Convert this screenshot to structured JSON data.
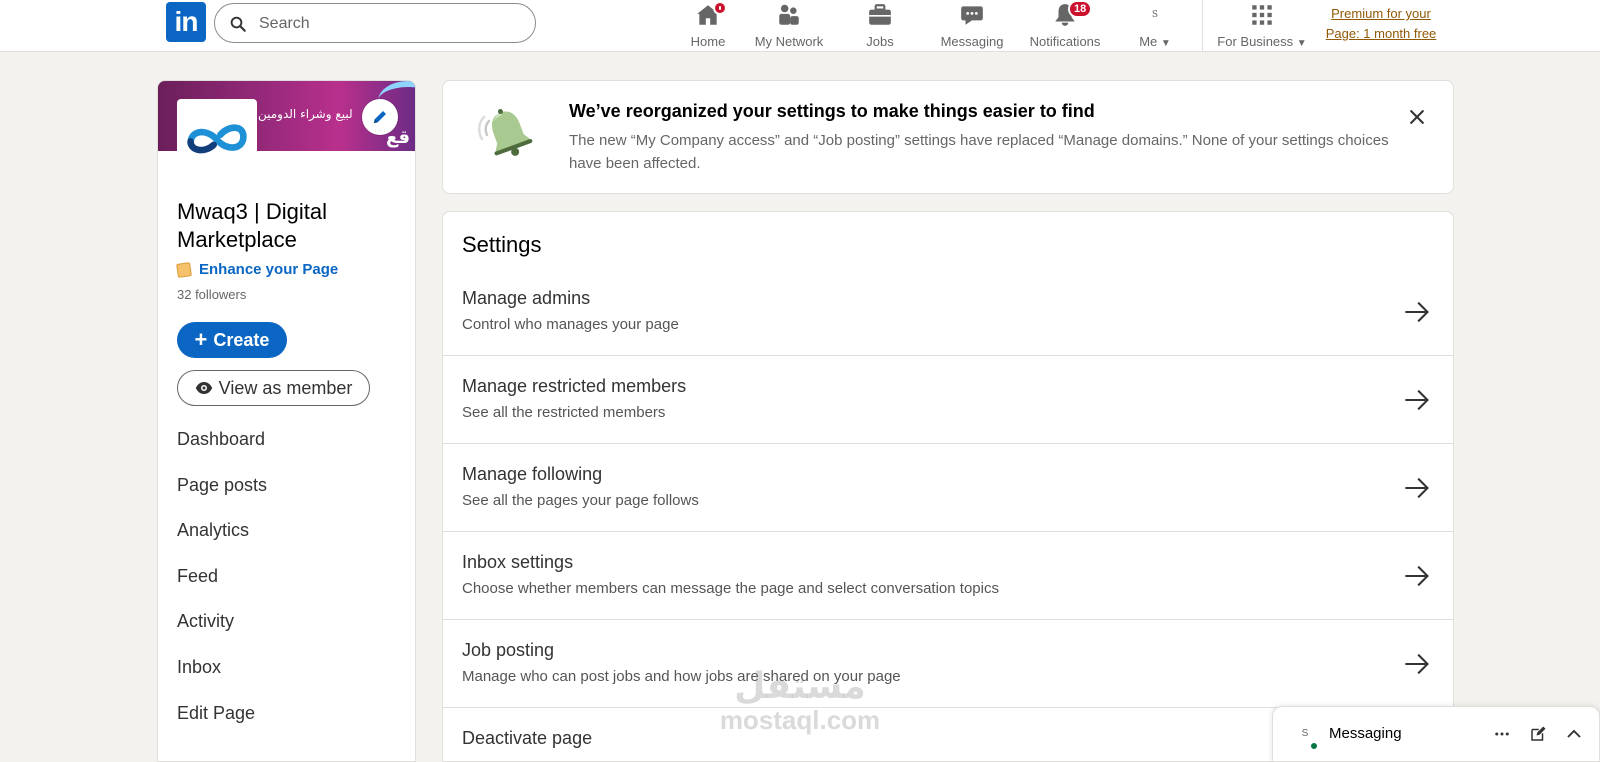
{
  "brand": {
    "logo_text": "in"
  },
  "search": {
    "placeholder": "Search"
  },
  "nav": [
    {
      "label": "Home",
      "icon": "home-icon",
      "badge": "dot"
    },
    {
      "label": "My Network",
      "icon": "people-icon"
    },
    {
      "label": "Jobs",
      "icon": "briefcase-icon"
    },
    {
      "label": "Messaging",
      "icon": "chat-icon"
    },
    {
      "label": "Notifications",
      "icon": "bell-icon",
      "badge": "18"
    },
    {
      "label": "Me",
      "icon": "avatar-icon",
      "avatar_text": "S"
    },
    {
      "label": "For Business",
      "icon": "grid-icon"
    }
  ],
  "premium": {
    "line1": "Premium for your",
    "line2": "Page: 1 month free"
  },
  "company": {
    "banner_text": "لبيع وشراء الدومين",
    "banner_arabic": "قع",
    "name": "Mwaq3 | Digital Marketplace",
    "enhance_label": "Enhance your Page",
    "followers": "32 followers",
    "create_label": "Create",
    "view_label": "View as member"
  },
  "side_nav": [
    "Dashboard",
    "Page posts",
    "Analytics",
    "Feed",
    "Activity",
    "Inbox",
    "Edit Page"
  ],
  "notice": {
    "title": "We’ve reorganized your settings to make things easier to find",
    "body": "The new “My Company access” and “Job posting” settings have replaced “Manage domains.” None of your settings choices have been affected."
  },
  "settings": {
    "heading": "Settings",
    "rows": [
      {
        "title": "Manage admins",
        "subtitle": "Control who manages your page"
      },
      {
        "title": "Manage restricted members",
        "subtitle": "See all the restricted members"
      },
      {
        "title": "Manage following",
        "subtitle": "See all the pages your page follows"
      },
      {
        "title": "Inbox settings",
        "subtitle": "Choose whether members can message the page and select conversation topics"
      },
      {
        "title": "Job posting",
        "subtitle": "Manage who can post jobs and how jobs are shared on your page"
      },
      {
        "title": "Deactivate page",
        "subtitle": ""
      }
    ]
  },
  "watermark": {
    "arabic": "مستقل",
    "latin": "mostaql.com"
  },
  "messaging_bar": {
    "title": "Messaging",
    "avatar_text": "S"
  },
  "colors": {
    "brand_blue": "#0a66c2",
    "premium_gold": "#915907",
    "badge_red": "#cb112d",
    "page_bg": "#f4f2ee"
  }
}
